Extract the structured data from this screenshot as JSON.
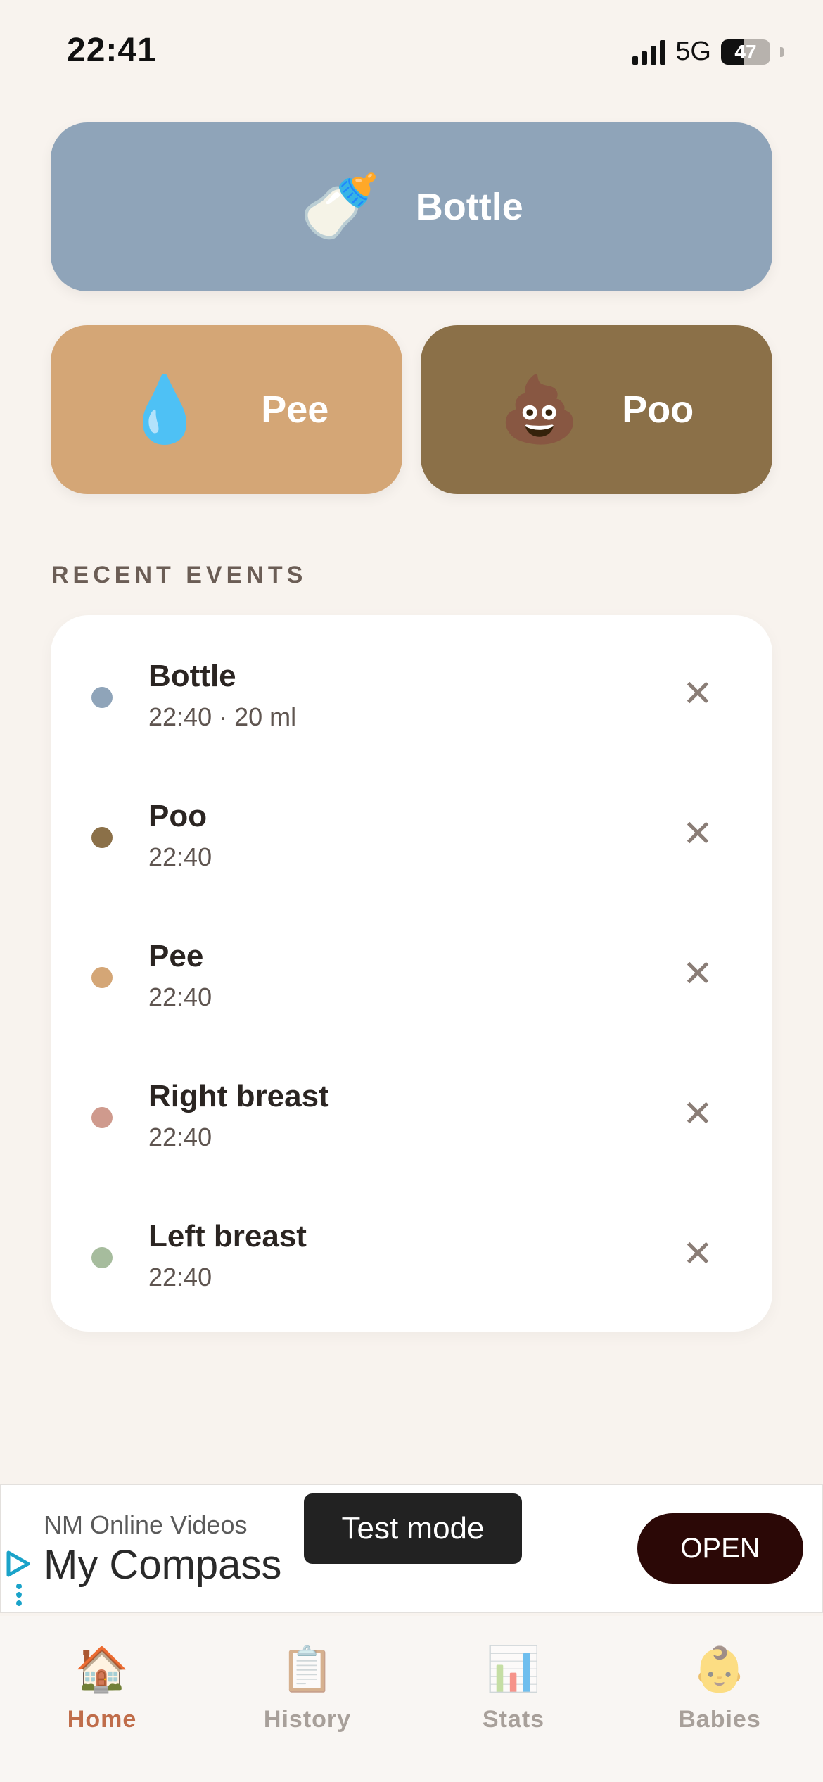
{
  "status_bar": {
    "time": "22:41",
    "network": "5G",
    "battery": "47",
    "battery_level": 0.47
  },
  "actions": {
    "bottle": {
      "emoji": "🍼",
      "label": "Bottle"
    },
    "pee": {
      "emoji": "💧",
      "label": "Pee"
    },
    "poo": {
      "emoji": "💩",
      "label": "Poo"
    }
  },
  "recent_events": {
    "title": "RECENT EVENTS",
    "items": [
      {
        "title": "Bottle",
        "subtitle": "22:40 · 20 ml",
        "color": "#8fa4b9"
      },
      {
        "title": "Poo",
        "subtitle": "22:40",
        "color": "#8b7048"
      },
      {
        "title": "Pee",
        "subtitle": "22:40",
        "color": "#d4a676"
      },
      {
        "title": "Right breast",
        "subtitle": "22:40",
        "color": "#cf9a8d"
      },
      {
        "title": "Left breast",
        "subtitle": "22:40",
        "color": "#a6bc9d"
      }
    ],
    "remove_glyph": "✕"
  },
  "ad": {
    "advertiser": "NM Online Videos",
    "title": "My Compass",
    "badge": "Test mode",
    "cta": "OPEN"
  },
  "tabs": [
    {
      "icon": "🏠",
      "label": "Home",
      "active": true
    },
    {
      "icon": "📋",
      "label": "History",
      "active": false
    },
    {
      "icon": "📊",
      "label": "Stats",
      "active": false
    },
    {
      "icon": "👶",
      "label": "Babies",
      "active": false
    }
  ]
}
